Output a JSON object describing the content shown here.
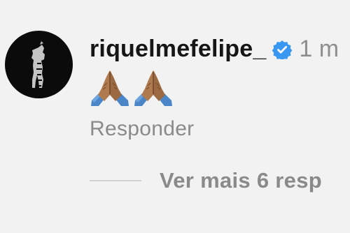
{
  "comment": {
    "username": "riquelmefelipe_",
    "timestamp": "1 m",
    "verified": true,
    "body_emoji": "🙏🙏",
    "emoji_icons": [
      "folded-hands-icon",
      "folded-hands-icon"
    ],
    "reply_label": "Responder",
    "more_replies_label": "Ver mais 6 resp"
  },
  "colors": {
    "verified_blue": "#3897f0",
    "muted_text": "#8a8a8a",
    "username_text": "#161616"
  }
}
